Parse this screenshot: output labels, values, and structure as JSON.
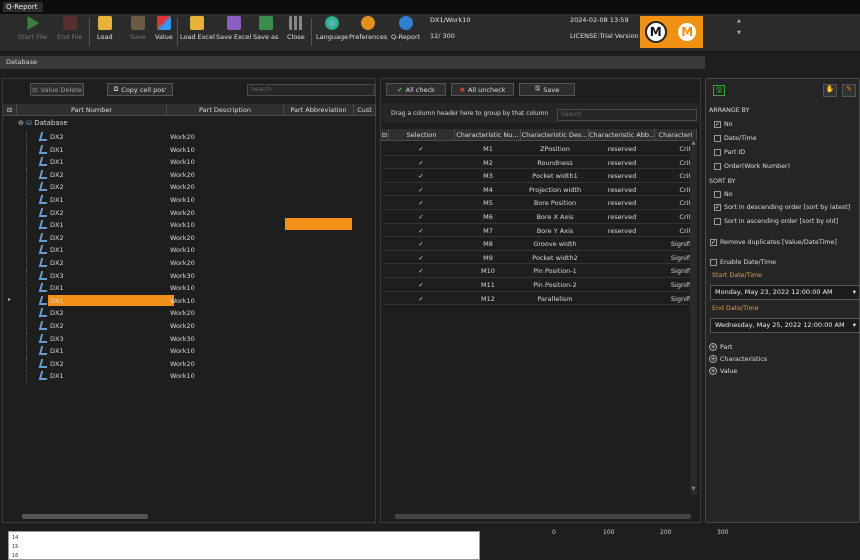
{
  "app": {
    "title": "Q-Report"
  },
  "toolbar": {
    "start_file": "Start File",
    "end_file": "End File",
    "load": "Load",
    "save": "Save",
    "value": "Value",
    "load_excel": "Load Excel",
    "save_excel": "Save Excel",
    "save_as": "Save as",
    "close": "Close",
    "language": "Language",
    "preferences": "Preferences",
    "q_report": "Q-Report"
  },
  "info": {
    "path": "DX1/Work10",
    "count": "12/ 300",
    "datetime": "2024-02-08 13:59",
    "license": "LICENSE:Trial Version"
  },
  "database": {
    "header": "Database",
    "value_delete": "Value Delete",
    "copy_cell_pos": "Copy cell pos'",
    "search_placeholder": "Search",
    "columns": [
      "Part Number",
      "Part Description",
      "Part Abbreviation",
      "Cust"
    ],
    "root": "Database",
    "rows": [
      {
        "pn": "DX2",
        "pd": "Work20"
      },
      {
        "pn": "DX1",
        "pd": "Work10"
      },
      {
        "pn": "DX1",
        "pd": "Work10"
      },
      {
        "pn": "DX2",
        "pd": "Work20"
      },
      {
        "pn": "DX2",
        "pd": "Work20"
      },
      {
        "pn": "DX1",
        "pd": "Work10"
      },
      {
        "pn": "DX2",
        "pd": "Work20"
      },
      {
        "pn": "DX1",
        "pd": "Work10"
      },
      {
        "pn": "DX2",
        "pd": "Work20"
      },
      {
        "pn": "DX1",
        "pd": "Work10"
      },
      {
        "pn": "DX2",
        "pd": "Work20"
      },
      {
        "pn": "DX3",
        "pd": "Work30"
      },
      {
        "pn": "DX1",
        "pd": "Work10"
      },
      {
        "pn": "DX1",
        "pd": "Work10"
      },
      {
        "pn": "DX2",
        "pd": "Work20"
      },
      {
        "pn": "DX2",
        "pd": "Work20"
      },
      {
        "pn": "DX3",
        "pd": "Work30"
      },
      {
        "pn": "DX1",
        "pd": "Work10"
      },
      {
        "pn": "DX2",
        "pd": "Work20"
      },
      {
        "pn": "DX1",
        "pd": "Work10"
      }
    ]
  },
  "characteristics": {
    "all_check": "All check",
    "all_uncheck": "All uncheck",
    "save": "Save",
    "group_hint": "Drag a column header here to group by that column",
    "search_placeholder": "Search",
    "columns": [
      "Selection",
      "Characteristic Nu...",
      "Characteristic Des...",
      "Characteristic Abb...",
      "Characteri"
    ],
    "rows": [
      {
        "num": "M1",
        "desc": "ZPosition",
        "abb": "reserved",
        "typ": "Crit"
      },
      {
        "num": "M2",
        "desc": "Roundness",
        "abb": "reserved",
        "typ": "Crit"
      },
      {
        "num": "M3",
        "desc": "Pocket width1",
        "abb": "reserved",
        "typ": "Crit"
      },
      {
        "num": "M4",
        "desc": "Projection width",
        "abb": "reserved",
        "typ": "Crit"
      },
      {
        "num": "M5",
        "desc": "Bore Position",
        "abb": "reserved",
        "typ": "Crit"
      },
      {
        "num": "M6",
        "desc": "Bore X Axis",
        "abb": "reserved",
        "typ": "Crit"
      },
      {
        "num": "M7",
        "desc": "Bore Y Axis",
        "abb": "reserved",
        "typ": "Crit"
      },
      {
        "num": "M8",
        "desc": "Groove width",
        "abb": "",
        "typ": "Signifi"
      },
      {
        "num": "M9",
        "desc": "Pocket width2",
        "abb": "",
        "typ": "Signifi"
      },
      {
        "num": "M10",
        "desc": "Pin Position-1",
        "abb": "",
        "typ": "Signifi"
      },
      {
        "num": "M11",
        "desc": "Pin Position-2",
        "abb": "",
        "typ": "Signifi"
      },
      {
        "num": "M12",
        "desc": "Parallelism",
        "abb": "",
        "typ": "Signifi"
      }
    ]
  },
  "side": {
    "arrange_by": "ARRANGE BY",
    "arr_no": "No",
    "arr_datetime": "Date/Time",
    "arr_partid": "Part ID",
    "arr_order": "Order(Work Number)",
    "sort_by": "SORT BY",
    "sort_no": "No",
    "sort_desc": "Sort in descending order [sort by latest]",
    "sort_asc": "Sort in ascending order [sort by old]",
    "remove_dup": "Remove duplicates [Value/DateTime]",
    "enable_dt": "Enable Date/Time",
    "start_label": "Start Date/Time",
    "start_value": "Monday, May 23, 2022 12:00:00 AM",
    "end_label": "End Date/Time",
    "end_value": "Wednesday, May 25, 2022 12:00:00 AM",
    "tree": [
      "Part",
      "Characteristics",
      "Value"
    ]
  },
  "bottom": {
    "ticks": [
      "0",
      "100",
      "200",
      "300"
    ]
  },
  "colors": {
    "accent": "#f09014"
  }
}
